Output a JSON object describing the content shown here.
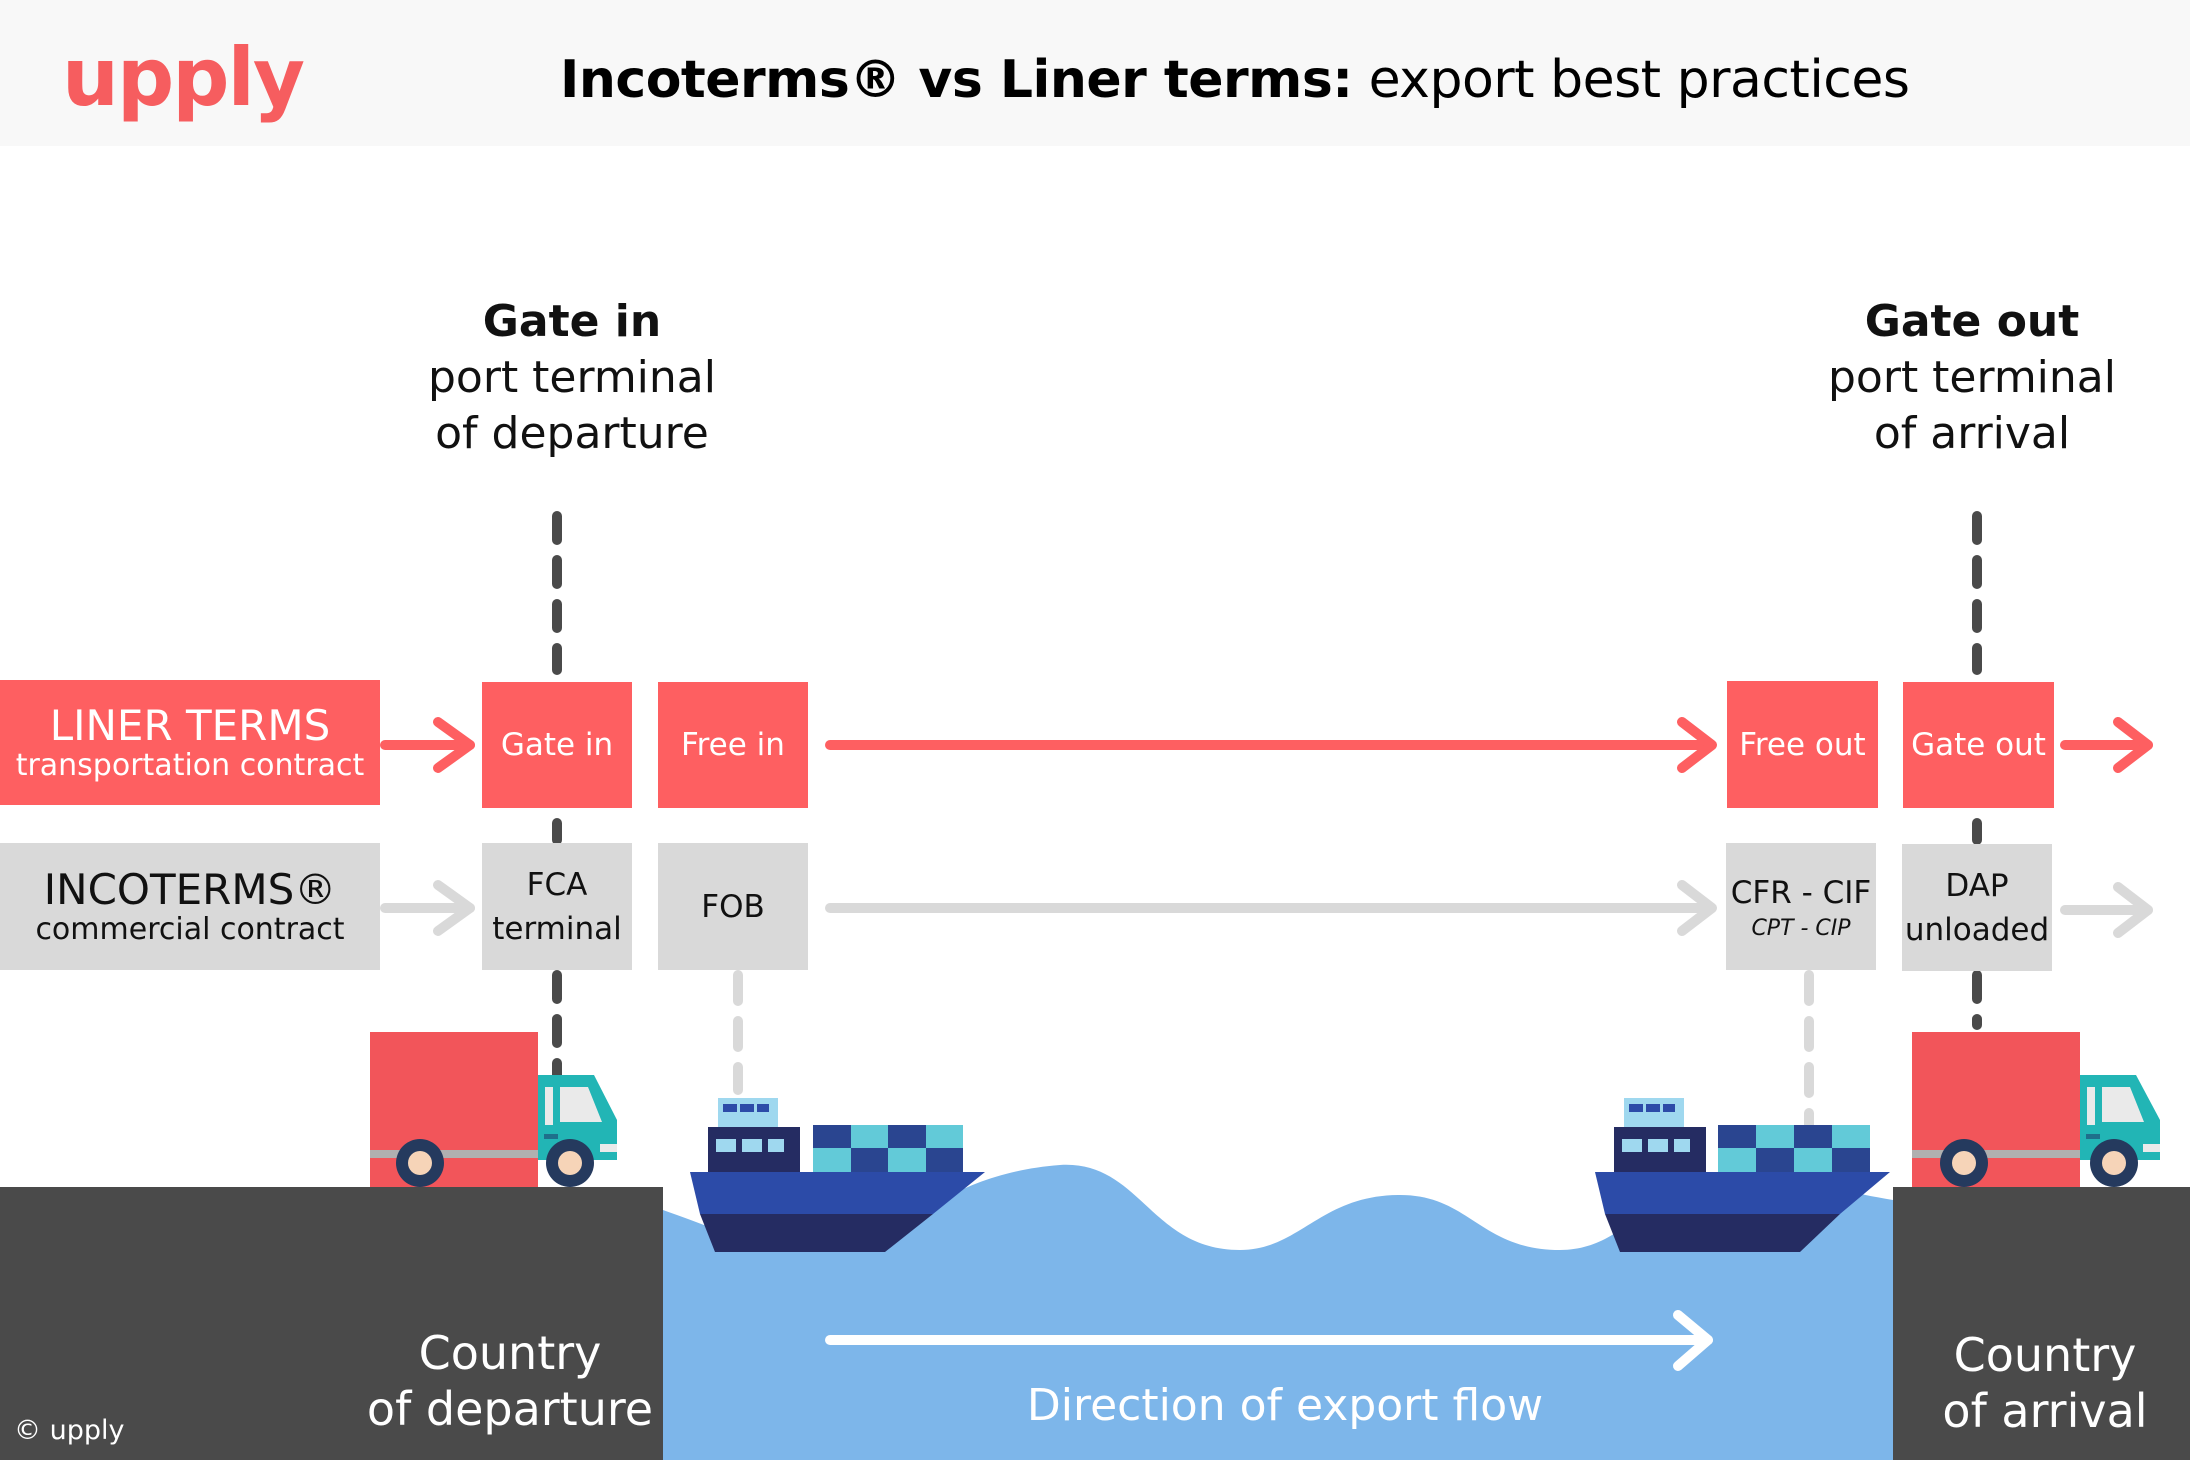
{
  "header": {
    "logo": "upply",
    "title_bold": "Incoterms® vs Liner terms:",
    "title_regular": " export best practices"
  },
  "headings": {
    "departure": {
      "bold": "Gate in",
      "line1": "port terminal",
      "line2": "of departure"
    },
    "arrival": {
      "bold": "Gate out",
      "line1": "port terminal",
      "line2": "of arrival"
    }
  },
  "rows": {
    "liner": {
      "title": "LINER TERMS",
      "subtitle": "transportation contract",
      "cells": [
        "Gate in",
        "Free in",
        "Free out",
        "Gate out"
      ]
    },
    "incoterms": {
      "title": "INCOTERMS®",
      "subtitle": "commercial contract",
      "cells": [
        {
          "line1": "FCA",
          "line2": "terminal"
        },
        {
          "line1": "FOB"
        },
        {
          "line1": "CFR - CIF",
          "line2": "CPT - CIP"
        },
        {
          "line1": "DAP",
          "line2": "unloaded"
        }
      ]
    }
  },
  "ground": {
    "departure": {
      "line1": "Country",
      "line2": "of departure"
    },
    "arrival": {
      "line1": "Country",
      "line2": "of arrival"
    },
    "flow_label": "Direction of export flow",
    "copyright": "© upply"
  },
  "colors": {
    "accent_red": "#fe5f61",
    "box_gray": "#d9d9d9",
    "ground": "#4a4a4a",
    "water": "#7db6ea",
    "ship_blue": "#2c4ba8",
    "ship_dark": "#252c62",
    "truck_red": "#f2555a",
    "truck_cab": "#22b5b5"
  }
}
